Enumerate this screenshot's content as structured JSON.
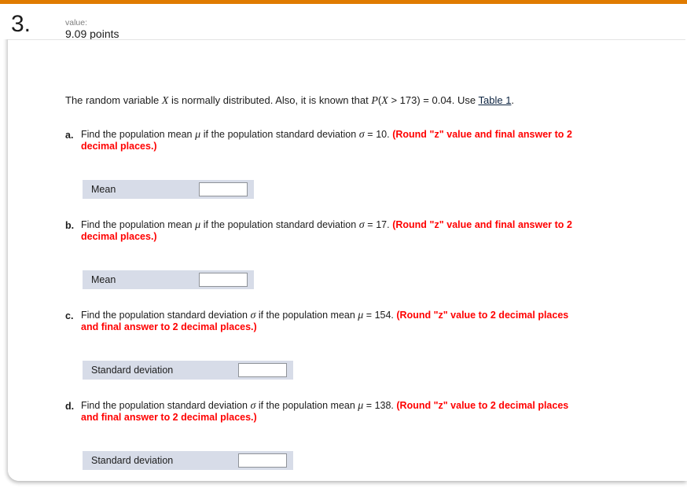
{
  "theme": {
    "accent_orange": "#e07b00",
    "answer_bar_bg": "#d7dce8",
    "instruction_red": "#ff0000",
    "link_color": "#0c2340"
  },
  "header": {
    "question_number": "3.",
    "value_label": "value:",
    "value_amount": "9.09 points"
  },
  "question": {
    "stem_part1": "The random variable ",
    "stem_var": "X",
    "stem_part2": " is normally distributed. Also, it is known that ",
    "stem_prob_p": "P",
    "stem_prob_open": "(",
    "stem_prob_var": "X",
    "stem_prob_rest": " > 173) = 0.04. Use ",
    "stem_link": "Table 1",
    "stem_end": "."
  },
  "parts": [
    {
      "letter": "a.",
      "text_before": "Find the population mean ",
      "symbol1": "μ",
      "text_mid": " if the population standard deviation ",
      "symbol2": "σ",
      "text_after": " = 10. ",
      "instruction": "(Round \"z\" value and final answer to 2 decimal places.)",
      "answer_label": "Mean",
      "answer_value": "",
      "answer_placeholder": ""
    },
    {
      "letter": "b.",
      "text_before": "Find the population mean ",
      "symbol1": "μ",
      "text_mid": " if the population standard deviation ",
      "symbol2": "σ",
      "text_after": " = 17. ",
      "instruction": "(Round \"z\" value and final answer to 2 decimal places.)",
      "answer_label": "Mean",
      "answer_value": "",
      "answer_placeholder": ""
    },
    {
      "letter": "c.",
      "text_before": "Find the population standard deviation ",
      "symbol1": "σ",
      "text_mid": " if the population mean ",
      "symbol2": "μ",
      "text_after": " = 154. ",
      "instruction": "(Round \"z\" value to 2 decimal places and final answer to 2 decimal places.)",
      "answer_label": "Standard deviation",
      "answer_value": "",
      "answer_placeholder": ""
    },
    {
      "letter": "d.",
      "text_before": "Find the population standard deviation ",
      "symbol1": "σ",
      "text_mid": " if the population mean ",
      "symbol2": "μ",
      "text_after": " = 138. ",
      "instruction": "(Round \"z\" value to 2 decimal places and final answer to 2 decimal places.)",
      "answer_label": "Standard deviation",
      "answer_value": "",
      "answer_placeholder": ""
    }
  ]
}
